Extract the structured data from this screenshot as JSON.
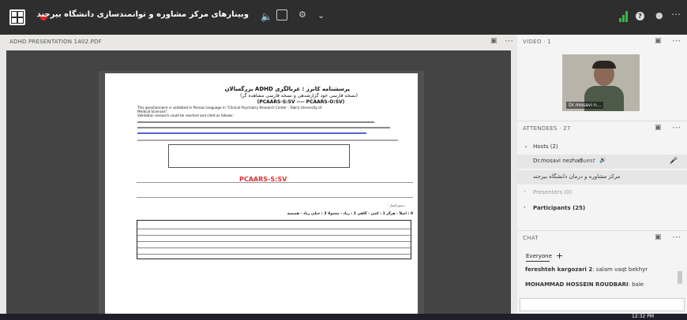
{
  "header": {
    "title": "وبینارهای مرکز مشاوره و توانمندسازی دانشگاه بیرجند",
    "recording": true
  },
  "presentation": {
    "filename": "ADHD PRESENTATION 1402.PDF",
    "doc": {
      "title_fa": "پرسشنامه کانرز : غربالگری ADHD بزرگسالان",
      "subtitle_fa": "(نسخه فارسی خود گزارشدهی و نسخه فارسی مشاهده گر)",
      "codes": "(PCAARS-S:SV   ----   PCAARS-O:SV)",
      "line1": "This questionnaire is validated in Persian language in \"Clinical Psychiatry Research Center - Tabriz University of",
      "line2": "Medical Sciences\".",
      "line3": "Validation research could be reached and cited as follows:",
      "form_title": "PCAARS-S:SV",
      "section": "دستورالعمل :",
      "scale": "0 : اصلاً - هرگز   1 : کمی - گاهی   2 : زیاد - معمولا   3 : خیلی زیاد - همیشه"
    }
  },
  "video": {
    "title": "VIDEO",
    "count": "1",
    "name": "Dr.mosavi n..."
  },
  "attendees": {
    "title": "ATTENDEES",
    "count": "27",
    "hosts_label": "Hosts (2)",
    "host1": "Dr.mosavi nezhad",
    "host1_role": "Guest",
    "host2": "مرکز مشاوره و درمان دانشگاه بیرجند",
    "presenters_label": "Presenters (0)",
    "participants_label": "Participants (25)"
  },
  "chat": {
    "title": "CHAT",
    "tab": "Everyone",
    "messages": [
      {
        "sender": "fereshteh kargozari 2",
        "text": "salam vaqt bekhyr"
      },
      {
        "sender": "MOHAMMAD HOSSEIN ROUDBARI",
        "text": "bale"
      }
    ]
  },
  "taskbar": {
    "time": "12:32 PM"
  },
  "colors": {
    "topbar": "#2e2e2e",
    "record": "#e22222",
    "signal": "#3fb24c"
  }
}
